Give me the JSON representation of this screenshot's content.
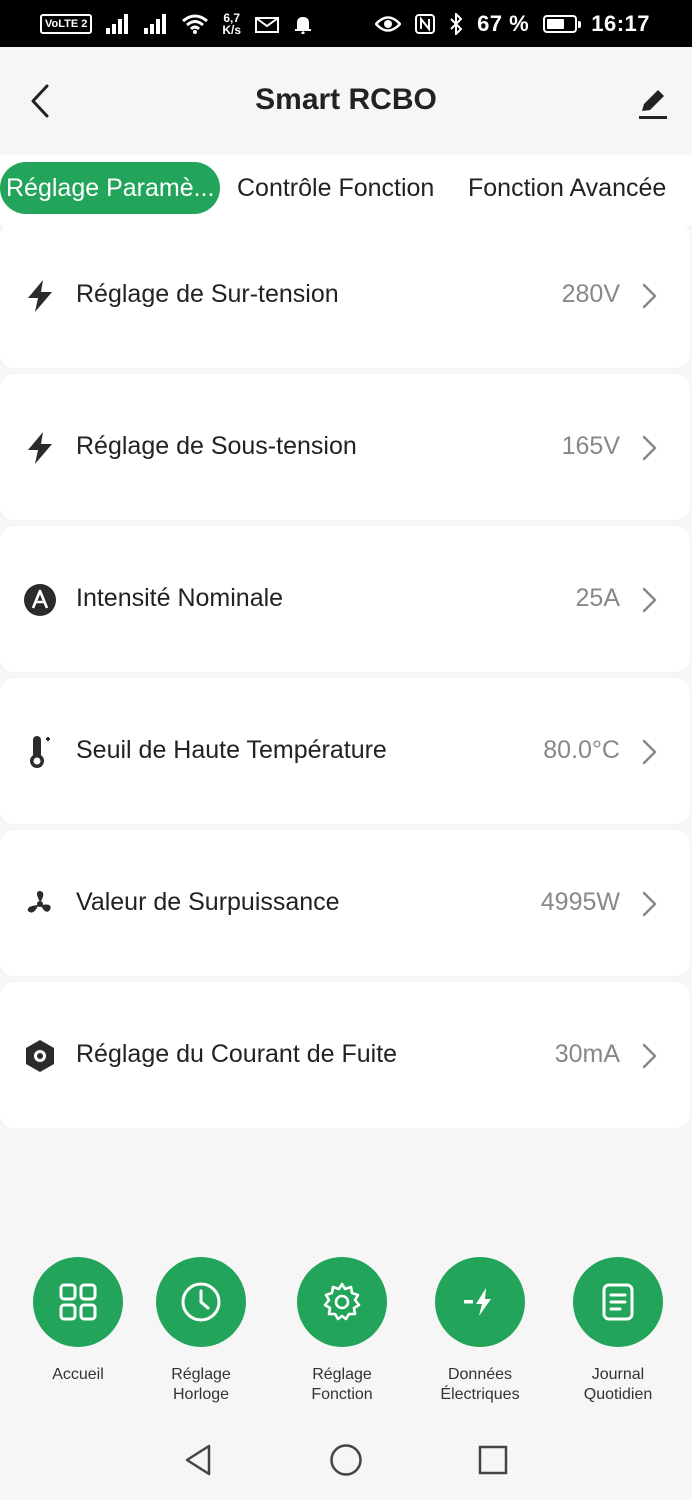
{
  "status_bar": {
    "volte": "VoLTE 2",
    "speed_top": "6,7",
    "speed_bottom": "K/s",
    "battery_percent": "67 %",
    "battery_level": 0.67,
    "time": "16:17"
  },
  "header": {
    "title": "Smart RCBO",
    "back_icon": "chevron-left-icon",
    "edit_icon": "pencil-icon"
  },
  "tabs": [
    {
      "label": "Réglage Paramè..."
    },
    {
      "label": "Contrôle Fonction"
    },
    {
      "label": "Fonction Avancée"
    }
  ],
  "active_tab": 0,
  "settings": [
    {
      "label": "Réglage de Sur-tension",
      "value": "280V",
      "icon": "lightning-icon"
    },
    {
      "label": "Réglage de Sous-tension",
      "value": "165V",
      "icon": "lightning-icon"
    },
    {
      "label": "Intensité Nominale",
      "value": "25A",
      "icon": "ampere-icon"
    },
    {
      "label": "Seuil de Haute Température",
      "value": "80.0°C",
      "icon": "thermometer-icon"
    },
    {
      "label": "Valeur de Surpuissance",
      "value": "4995W",
      "icon": "fan-icon"
    },
    {
      "label": "Réglage du Courant de Fuite",
      "value": "30mA",
      "icon": "hexagon-nut-icon"
    }
  ],
  "bottom_nav": [
    {
      "label_line1": "Accueil",
      "label_line2": "",
      "icon": "grid-icon"
    },
    {
      "label_line1": "Réglage",
      "label_line2": "Horloge",
      "icon": "clock-icon"
    },
    {
      "label_line1": "Réglage",
      "label_line2": "Fonction",
      "icon": "gear-icon"
    },
    {
      "label_line1": "Données",
      "label_line2": "Électriques",
      "icon": "electric-data-icon"
    },
    {
      "label_line1": "Journal",
      "label_line2": "Quotidien",
      "icon": "document-icon"
    }
  ],
  "colors": {
    "accent": "#22a55a",
    "background": "#f6f6f6",
    "card": "#ffffff",
    "value_text": "#888888"
  }
}
